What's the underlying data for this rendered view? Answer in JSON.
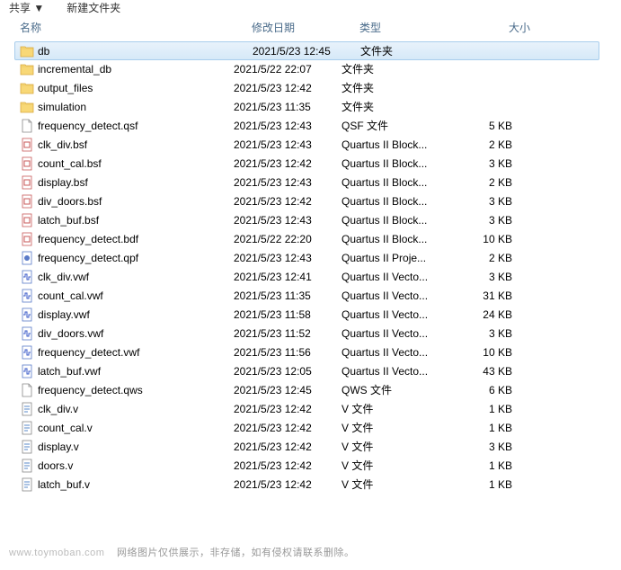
{
  "toolbar": {
    "item1": "共享 ▼",
    "item2": "新建文件夹"
  },
  "columns": {
    "name": "名称",
    "date": "修改日期",
    "type": "类型",
    "size": "大小"
  },
  "files": [
    {
      "icon": "folder",
      "name": "db",
      "date": "2021/5/23 12:45",
      "type": "文件夹",
      "size": "",
      "selected": true
    },
    {
      "icon": "folder",
      "name": "incremental_db",
      "date": "2021/5/22 22:07",
      "type": "文件夹",
      "size": ""
    },
    {
      "icon": "folder",
      "name": "output_files",
      "date": "2021/5/23 12:42",
      "type": "文件夹",
      "size": ""
    },
    {
      "icon": "folder",
      "name": "simulation",
      "date": "2021/5/23 11:35",
      "type": "文件夹",
      "size": ""
    },
    {
      "icon": "qsf",
      "name": "frequency_detect.qsf",
      "date": "2021/5/23 12:43",
      "type": "QSF 文件",
      "size": "5 KB"
    },
    {
      "icon": "bsf",
      "name": "clk_div.bsf",
      "date": "2021/5/23 12:43",
      "type": "Quartus II Block...",
      "size": "2 KB"
    },
    {
      "icon": "bsf",
      "name": "count_cal.bsf",
      "date": "2021/5/23 12:42",
      "type": "Quartus II Block...",
      "size": "3 KB"
    },
    {
      "icon": "bsf",
      "name": "display.bsf",
      "date": "2021/5/23 12:43",
      "type": "Quartus II Block...",
      "size": "2 KB"
    },
    {
      "icon": "bsf",
      "name": "div_doors.bsf",
      "date": "2021/5/23 12:42",
      "type": "Quartus II Block...",
      "size": "3 KB"
    },
    {
      "icon": "bsf",
      "name": "latch_buf.bsf",
      "date": "2021/5/23 12:43",
      "type": "Quartus II Block...",
      "size": "3 KB"
    },
    {
      "icon": "bdf",
      "name": "frequency_detect.bdf",
      "date": "2021/5/22 22:20",
      "type": "Quartus II Block...",
      "size": "10 KB"
    },
    {
      "icon": "qpf",
      "name": "frequency_detect.qpf",
      "date": "2021/5/23 12:43",
      "type": "Quartus II Proje...",
      "size": "2 KB"
    },
    {
      "icon": "vwf",
      "name": "clk_div.vwf",
      "date": "2021/5/23 12:41",
      "type": "Quartus II Vecto...",
      "size": "3 KB"
    },
    {
      "icon": "vwf",
      "name": "count_cal.vwf",
      "date": "2021/5/23 11:35",
      "type": "Quartus II Vecto...",
      "size": "31 KB"
    },
    {
      "icon": "vwf",
      "name": "display.vwf",
      "date": "2021/5/23 11:58",
      "type": "Quartus II Vecto...",
      "size": "24 KB"
    },
    {
      "icon": "vwf",
      "name": "div_doors.vwf",
      "date": "2021/5/23 11:52",
      "type": "Quartus II Vecto...",
      "size": "3 KB"
    },
    {
      "icon": "vwf",
      "name": "frequency_detect.vwf",
      "date": "2021/5/23 11:56",
      "type": "Quartus II Vecto...",
      "size": "10 KB"
    },
    {
      "icon": "vwf",
      "name": "latch_buf.vwf",
      "date": "2021/5/23 12:05",
      "type": "Quartus II Vecto...",
      "size": "43 KB"
    },
    {
      "icon": "qws",
      "name": "frequency_detect.qws",
      "date": "2021/5/23 12:45",
      "type": "QWS 文件",
      "size": "6 KB"
    },
    {
      "icon": "v",
      "name": "clk_div.v",
      "date": "2021/5/23 12:42",
      "type": "V 文件",
      "size": "1 KB"
    },
    {
      "icon": "v",
      "name": "count_cal.v",
      "date": "2021/5/23 12:42",
      "type": "V 文件",
      "size": "1 KB"
    },
    {
      "icon": "v",
      "name": "display.v",
      "date": "2021/5/23 12:42",
      "type": "V 文件",
      "size": "3 KB"
    },
    {
      "icon": "v",
      "name": "doors.v",
      "date": "2021/5/23 12:42",
      "type": "V 文件",
      "size": "1 KB"
    },
    {
      "icon": "v",
      "name": "latch_buf.v",
      "date": "2021/5/23 12:42",
      "type": "V 文件",
      "size": "1 KB"
    }
  ],
  "footer": {
    "brand": "www.toymoban.com",
    "text": "网络图片仅供展示，非存储，如有侵权请联系删除。"
  }
}
